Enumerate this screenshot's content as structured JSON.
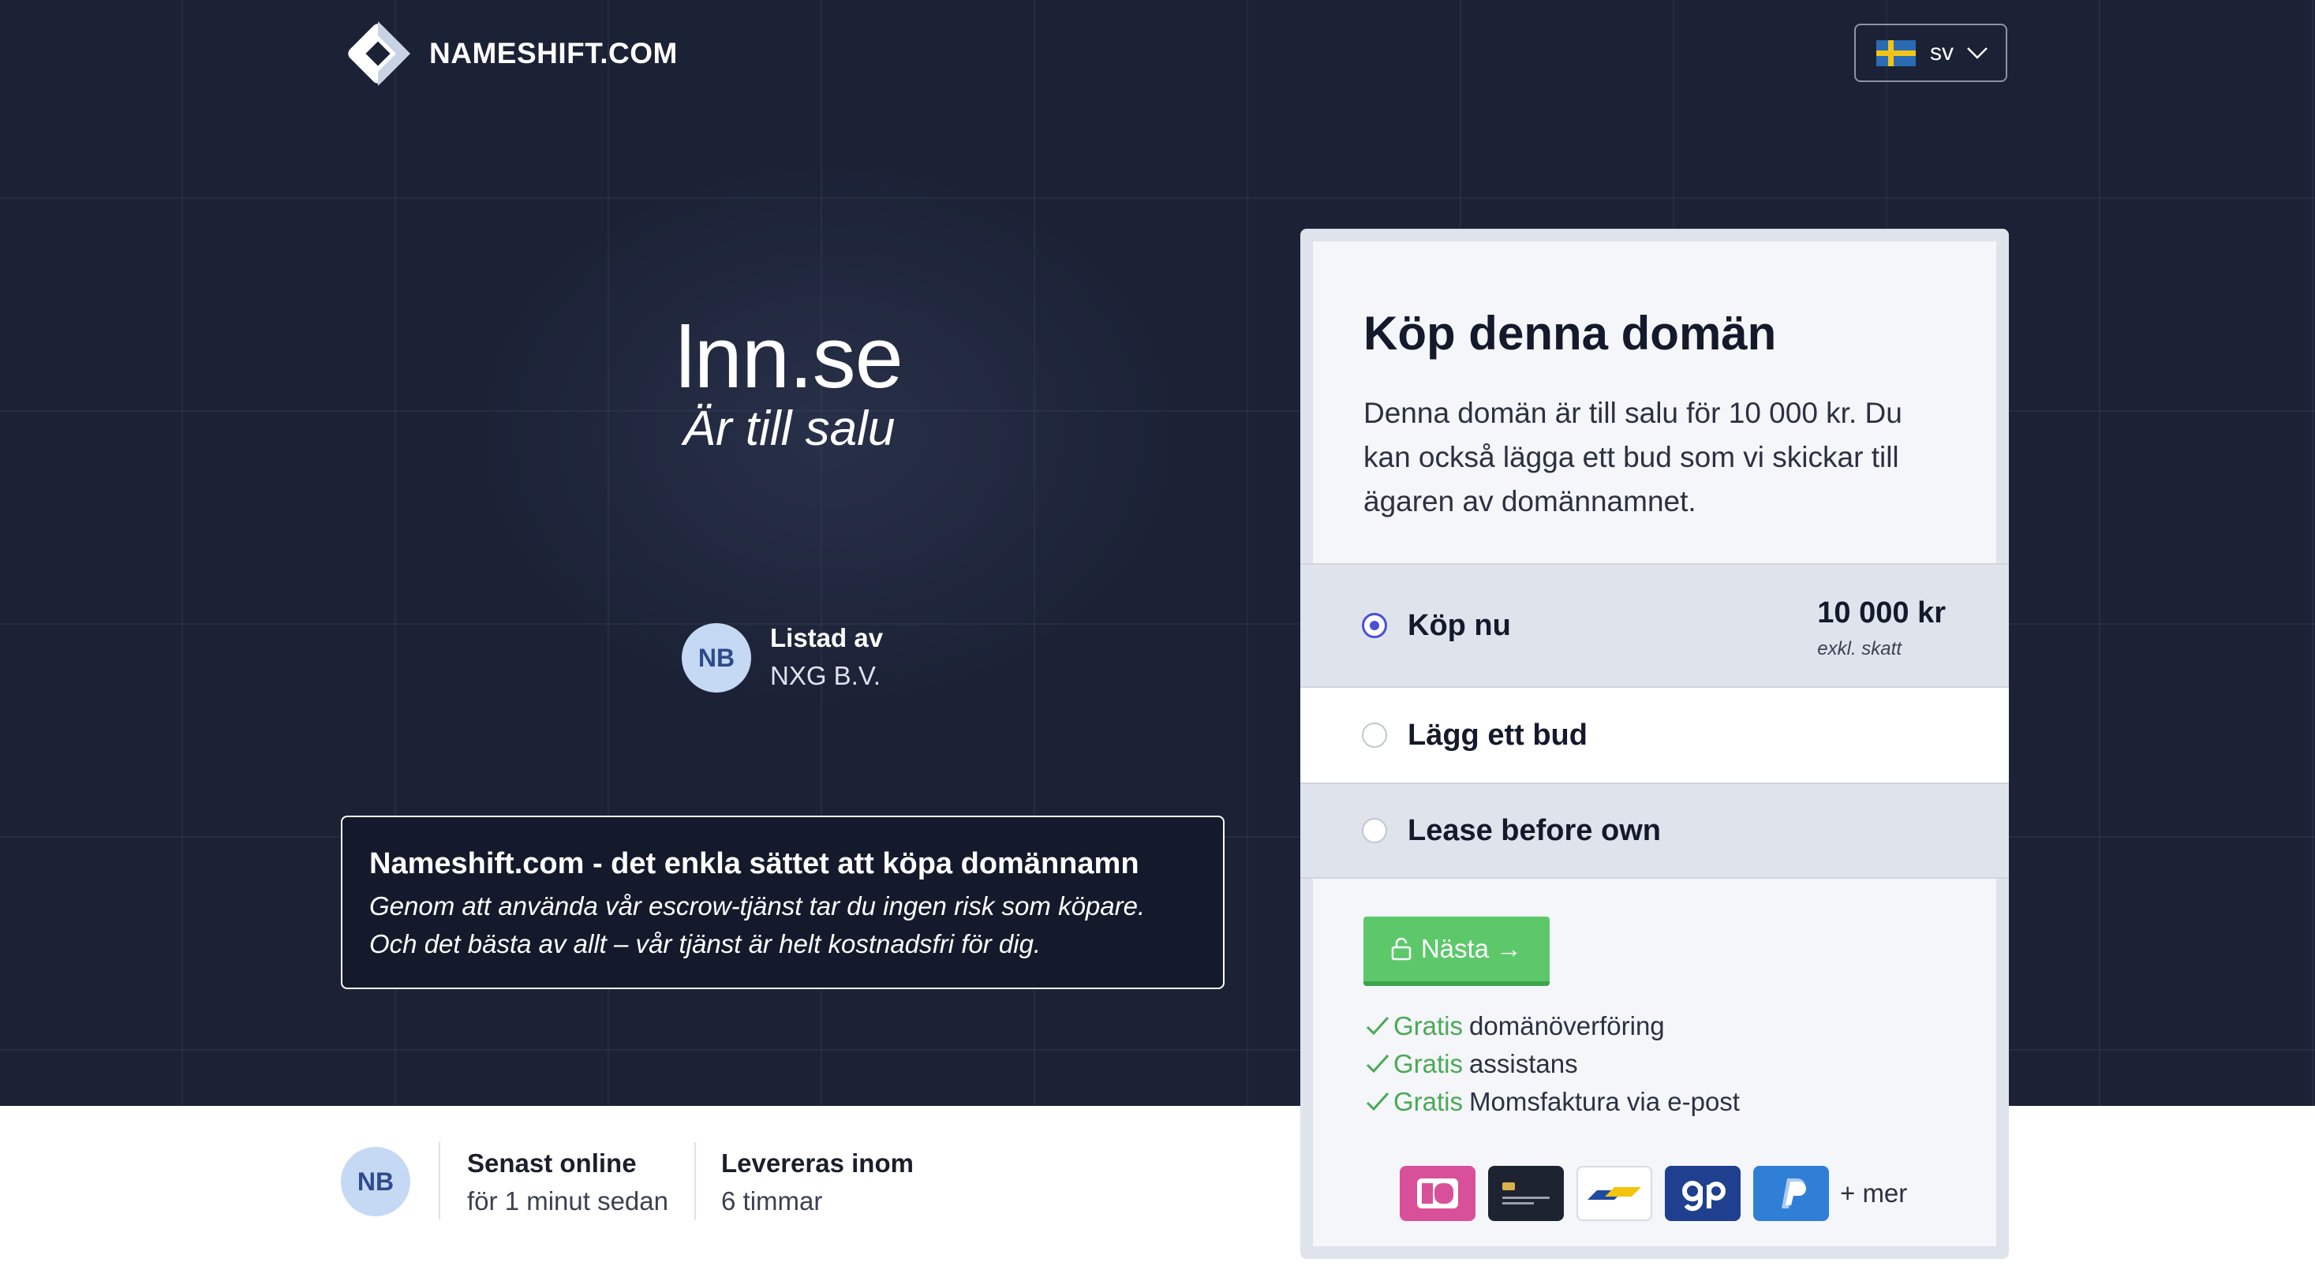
{
  "header": {
    "logo_text": "NAMESHIFT.COM",
    "language_code": "sv",
    "flag_icon": "sweden-flag-icon"
  },
  "hero": {
    "domain": "lnn.se",
    "subtitle": "Är till salu",
    "listed_label": "Listad av",
    "listed_value": "NXG B.V.",
    "seller_initials": "NB"
  },
  "info_box": {
    "title": "Nameshift.com - det enkla sättet att köpa domännamn",
    "text": "Genom att använda vår escrow-tjänst tar du ingen risk som köpare. Och det bästa av allt – vår tjänst är helt kostnadsfri för dig."
  },
  "seller_stats": {
    "initials": "NB",
    "last_online_label": "Senast online",
    "last_online_value": "för 1 minut sedan",
    "delivery_label": "Levereras inom",
    "delivery_value": "6 timmar"
  },
  "card": {
    "title": "Köp denna domän",
    "description": "Denna domän är till salu för 10 000 kr. Du kan också lägga ett bud som vi skickar till ägaren av domännamnet.",
    "options": [
      {
        "label": "Köp nu",
        "price": "10 000 kr",
        "note": "exkl. skatt",
        "selected": true
      },
      {
        "label": "Lägg ett bud",
        "selected": false
      },
      {
        "label": "Lease before own",
        "selected": false
      }
    ],
    "next_button": "Nästa →",
    "benefits": [
      {
        "highlight": "Gratis",
        "text": "domänöverföring"
      },
      {
        "highlight": "Gratis",
        "text": "assistans"
      },
      {
        "highlight": "Gratis",
        "text": "Momsfaktura via e-post"
      }
    ],
    "payment_icons": [
      "ideal-icon",
      "card-icon",
      "bancontact-icon",
      "giropay-icon",
      "paypal-icon"
    ],
    "more_payments": "+ mer"
  },
  "colors": {
    "hero_bg": "#1b2236",
    "accent_radio": "#4a4fd6",
    "button_green": "#5cc86a",
    "benefit_green": "#4aa956"
  }
}
